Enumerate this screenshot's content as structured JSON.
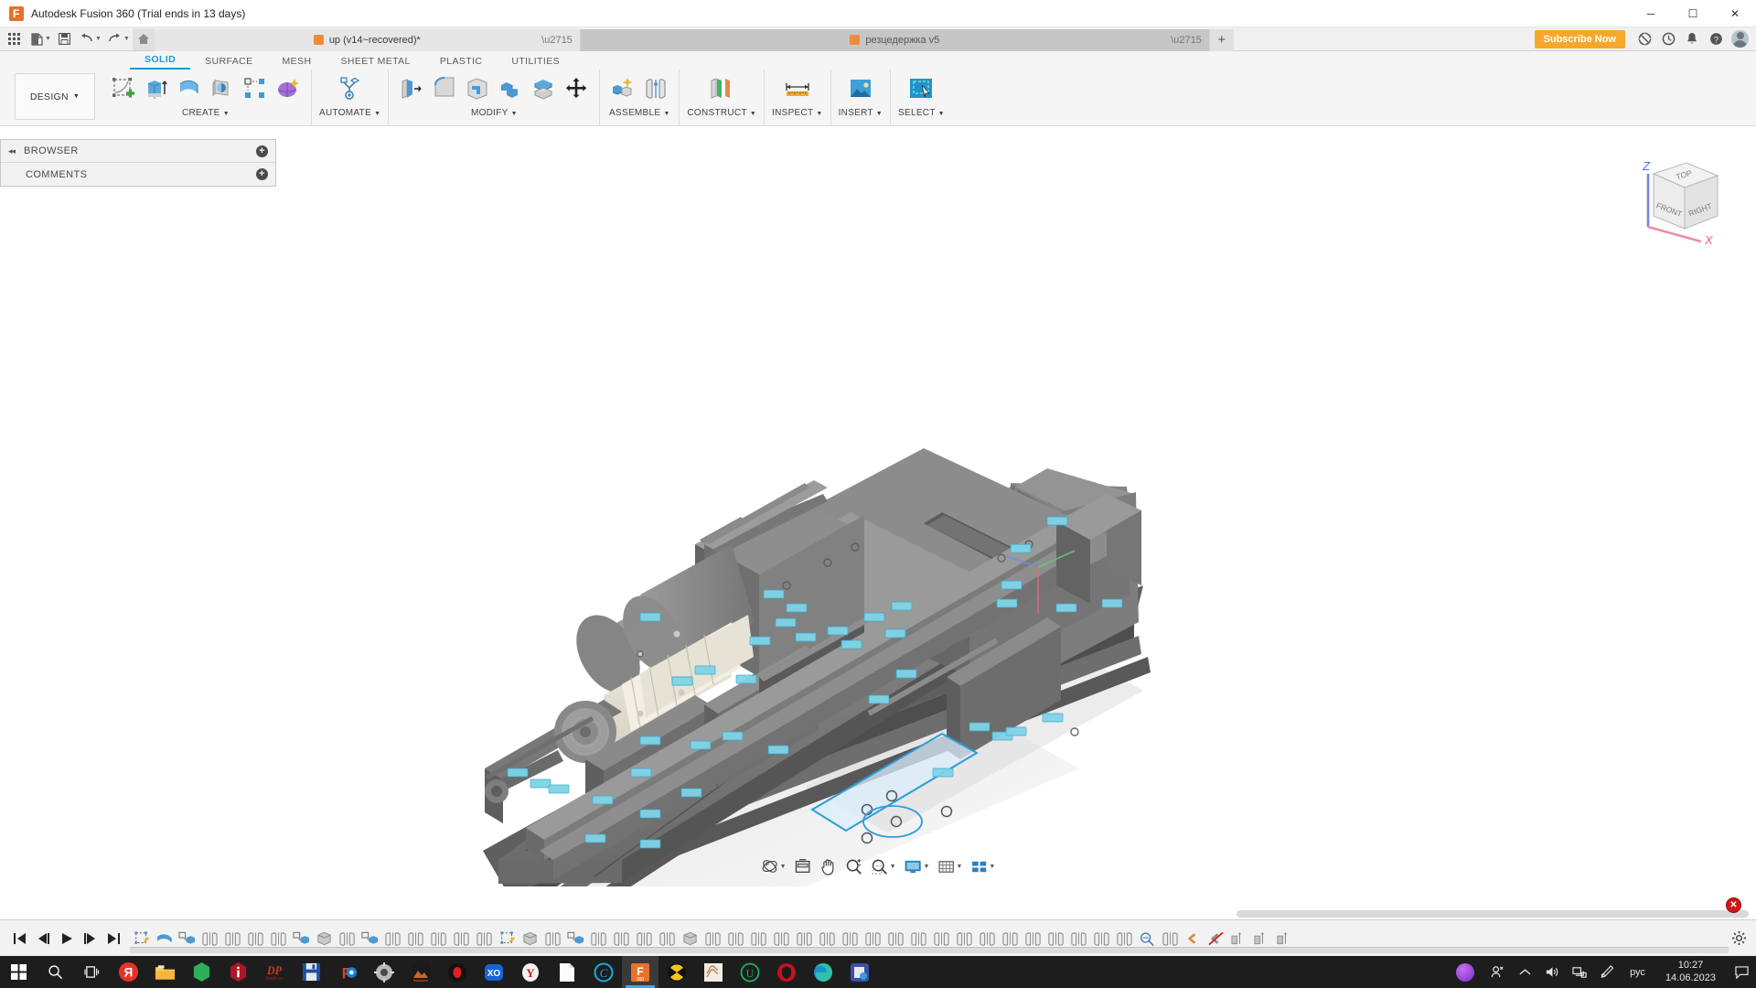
{
  "window": {
    "title": "Autodesk Fusion 360 (Trial ends in 13 days)",
    "app_icon": "fusion-logo-icon",
    "minimize": "─",
    "maximize": "☐",
    "close": "✕"
  },
  "quick_access": {
    "grid_icon": "app-grid-icon",
    "new_icon": "new-document-icon",
    "save_icon": "save-icon",
    "undo_icon": "undo-icon",
    "redo_icon": "redo-icon",
    "home_icon": "home-icon",
    "caret": "▼"
  },
  "document_tabs": [
    {
      "label": "up (v14~recovered)*",
      "active": true,
      "closable": true
    },
    {
      "label": "резцедержка v5",
      "active": false,
      "closable": true
    }
  ],
  "tab_bar_right": {
    "new_tab": "+",
    "subscribe_label": "Subscribe Now",
    "extensions_icon": "extensions-icon",
    "job_status_icon": "job-status-clock-icon",
    "notifications_icon": "bell-icon",
    "help_icon": "help-question-icon",
    "account_icon": "user-avatar"
  },
  "ribbon": {
    "design_label": "DESIGN",
    "design_caret": "▼",
    "tabs": [
      {
        "label": "SOLID",
        "active": true
      },
      {
        "label": "SURFACE",
        "active": false
      },
      {
        "label": "MESH",
        "active": false
      },
      {
        "label": "SHEET METAL",
        "active": false
      },
      {
        "label": "PLASTIC",
        "active": false
      },
      {
        "label": "UTILITIES",
        "active": false
      }
    ],
    "groups": [
      {
        "label": "CREATE",
        "caret": "▼",
        "tools": [
          "create-sketch-icon",
          "extrude-icon",
          "revolve-icon",
          "sweep-icon",
          "pattern-icon",
          "form-icon"
        ]
      },
      {
        "label": "AUTOMATE",
        "caret": "▼",
        "tools": [
          "automated-modeling-icon"
        ]
      },
      {
        "label": "MODIFY",
        "caret": "▼",
        "tools": [
          "press-pull-icon",
          "fillet-icon",
          "shell-icon",
          "combine-icon",
          "offset-face-icon",
          "move-copy-icon"
        ]
      },
      {
        "label": "ASSEMBLE",
        "caret": "▼",
        "tools": [
          "new-component-icon",
          "joint-icon"
        ]
      },
      {
        "label": "CONSTRUCT",
        "caret": "▼",
        "tools": [
          "offset-plane-icon"
        ]
      },
      {
        "label": "INSPECT",
        "caret": "▼",
        "tools": [
          "measure-icon"
        ]
      },
      {
        "label": "INSERT",
        "caret": "▼",
        "tools": [
          "insert-image-icon"
        ]
      },
      {
        "label": "SELECT",
        "caret": "▼",
        "tools": [
          "select-window-icon"
        ]
      }
    ]
  },
  "browser_panel": {
    "collapse_icon": "collapse-arrows-icon",
    "rows": [
      {
        "label": "BROWSER",
        "expander": "+"
      },
      {
        "label": "COMMENTS",
        "expander": "+"
      }
    ]
  },
  "viewcube": {
    "top_face": "TOP",
    "front_face": "FRONT",
    "right_face": "RIGHT",
    "axis_z": "Z",
    "axis_x": "X",
    "z_color": "#4b6cf5",
    "x_color": "#f05a7a"
  },
  "navigation_bar": {
    "items": [
      {
        "icon": "orbit-icon",
        "caret": "▼"
      },
      {
        "icon": "look-at-icon",
        "caret": ""
      },
      {
        "icon": "pan-hand-icon",
        "caret": ""
      },
      {
        "icon": "zoom-icon",
        "caret": ""
      },
      {
        "icon": "zoom-window-icon",
        "caret": "▼"
      },
      {
        "icon": "display-settings-icon",
        "caret": "▼"
      },
      {
        "icon": "grid-snaps-icon",
        "caret": "▼"
      },
      {
        "icon": "viewports-icon",
        "caret": "▼"
      }
    ]
  },
  "timeline": {
    "playback": [
      {
        "icon": "go-to-beginning-icon",
        "glyph": "⏮"
      },
      {
        "icon": "step-back-icon",
        "glyph": "◀❘"
      },
      {
        "icon": "play-icon",
        "glyph": "▶"
      },
      {
        "icon": "step-forward-icon",
        "glyph": "❘▶"
      },
      {
        "icon": "go-to-end-icon",
        "glyph": "⏭"
      }
    ],
    "features": [
      "sketch-icon",
      "revolve-icon",
      "new-component-icon",
      "mirror-icon",
      "mirror-icon",
      "mirror-icon",
      "mirror-icon",
      "new-component-icon",
      "extrude-icon",
      "mirror-icon",
      "new-component-icon",
      "mirror-icon",
      "mirror-icon",
      "mirror-icon",
      "mirror-icon",
      "mirror-icon",
      "sketch-icon",
      "extrude-icon",
      "mirror-icon",
      "new-component-icon",
      "mirror-icon",
      "mirror-icon",
      "mirror-icon",
      "mirror-icon",
      "extrude-icon",
      "mirror-icon",
      "mirror-icon",
      "mirror-icon",
      "mirror-icon",
      "mirror-icon",
      "mirror-icon",
      "mirror-icon",
      "mirror-icon",
      "mirror-icon",
      "mirror-icon",
      "mirror-icon",
      "mirror-icon",
      "mirror-icon",
      "mirror-icon",
      "mirror-icon",
      "mirror-icon",
      "mirror-icon",
      "mirror-icon",
      "mirror-icon",
      "inspect-icon",
      "mirror-icon",
      "joint-icon",
      "suppressed-joint-icon",
      "align-icon",
      "align-icon",
      "align-icon"
    ],
    "settings_icon": "timeline-settings-gear-icon",
    "error_badge": "✕",
    "scrollbar": "horizontal-scrollbar"
  },
  "canvas": {
    "sketch_plane_color": "#3fa9e0",
    "model_name": "lathe-carriage-assembly"
  },
  "taskbar": {
    "start_icon": "windows-start-icon",
    "search_icon": "search-icon",
    "taskview_icon": "task-view-icon",
    "apps": [
      {
        "icon": "yandex-browser-icon",
        "label": "Я",
        "active": false
      },
      {
        "icon": "file-explorer-icon",
        "label": "",
        "active": false
      },
      {
        "icon": "green-hex-app-icon",
        "label": "",
        "active": false
      },
      {
        "icon": "red-info-app-icon",
        "label": "",
        "active": false
      },
      {
        "icon": "deskproto-icon",
        "label": "DP",
        "active": false
      },
      {
        "icon": "floppy-save-app-icon",
        "label": "",
        "active": false
      },
      {
        "icon": "fusion-settings-icon",
        "label": "",
        "active": false
      },
      {
        "icon": "gear-app-icon",
        "label": "",
        "active": false
      },
      {
        "icon": "artcam-icon",
        "label": "",
        "active": false
      },
      {
        "icon": "record-app-icon",
        "label": "",
        "active": false
      },
      {
        "icon": "xo-app-icon",
        "label": "XO",
        "active": false
      },
      {
        "icon": "y-app-icon",
        "label": "Y",
        "active": false
      },
      {
        "icon": "notepad-icon",
        "label": "",
        "active": false
      },
      {
        "icon": "c-circle-app-icon",
        "label": "C",
        "active": false
      },
      {
        "icon": "fusion-360-icon",
        "label": "F",
        "active": true
      },
      {
        "icon": "radiation-app-icon",
        "label": "",
        "active": false
      },
      {
        "icon": "sketch-pattern-app-icon",
        "label": "",
        "active": false
      },
      {
        "icon": "u-circle-app-icon",
        "label": "U",
        "active": false
      },
      {
        "icon": "red-shield-app-icon",
        "label": "",
        "active": false
      },
      {
        "icon": "edge-browser-icon",
        "label": "",
        "active": false
      },
      {
        "icon": "blue-doc-app-icon",
        "label": "",
        "active": false
      }
    ],
    "tray": {
      "cortana_icon": "cortana-circle-icon",
      "people_icon": "people-icon",
      "chevron_icon": "show-hidden-icons-chevron",
      "volume_icon": "volume-icon",
      "network_icon": "network-icon",
      "pen_icon": "pen-icon",
      "language": "рус",
      "time": "10:27",
      "date": "14.06.2023",
      "notifications_icon": "action-center-icon"
    }
  }
}
